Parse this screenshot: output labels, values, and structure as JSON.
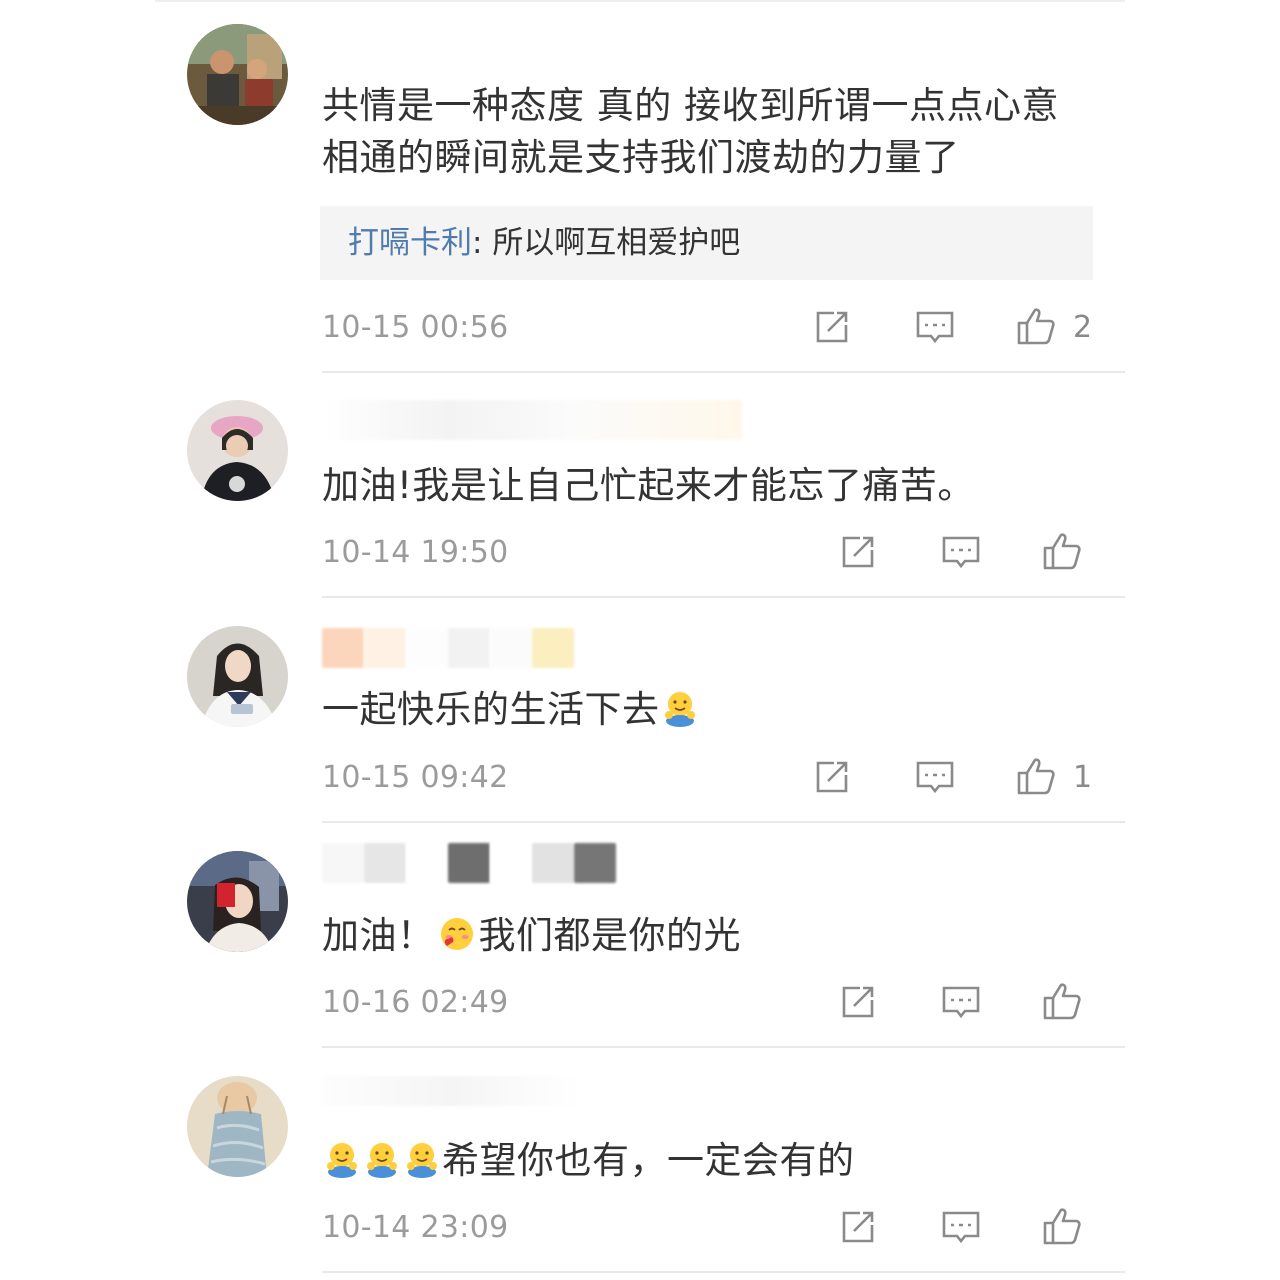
{
  "comments": [
    {
      "text": "共情是一种态度 真的 接收到所谓一点点心意相通的瞬间就是支持我们渡劫的力量了",
      "reply": {
        "name": "打嗝卡利",
        "sep": ": ",
        "text": "所以啊互相爱护吧"
      },
      "time": "10-15 00:56",
      "likes": "2"
    },
    {
      "text": "加油!我是让自己忙起来才能忘了痛苦。",
      "time": "10-14 19:50",
      "likes": ""
    },
    {
      "text": "一起快乐的生活下去",
      "time": "10-15 09:42",
      "likes": "1"
    },
    {
      "text_a": "加油！",
      "text_b": "我们都是你的光",
      "time": "10-16 02:49",
      "likes": ""
    },
    {
      "text": "希望你也有，一定会有的",
      "time": "10-14 23:09",
      "likes": ""
    }
  ],
  "icons": {
    "share": "share-icon",
    "reply": "comment-icon",
    "like": "thumbs-up-icon",
    "emoji_hug": "hug-emoji",
    "emoji_love": "love-emoji"
  },
  "colors": {
    "reply_name": "#4f7cac",
    "text": "#333333",
    "meta": "#9b9b9b",
    "reply_bg": "#f4f4f4",
    "divider": "#e9e9e9"
  }
}
